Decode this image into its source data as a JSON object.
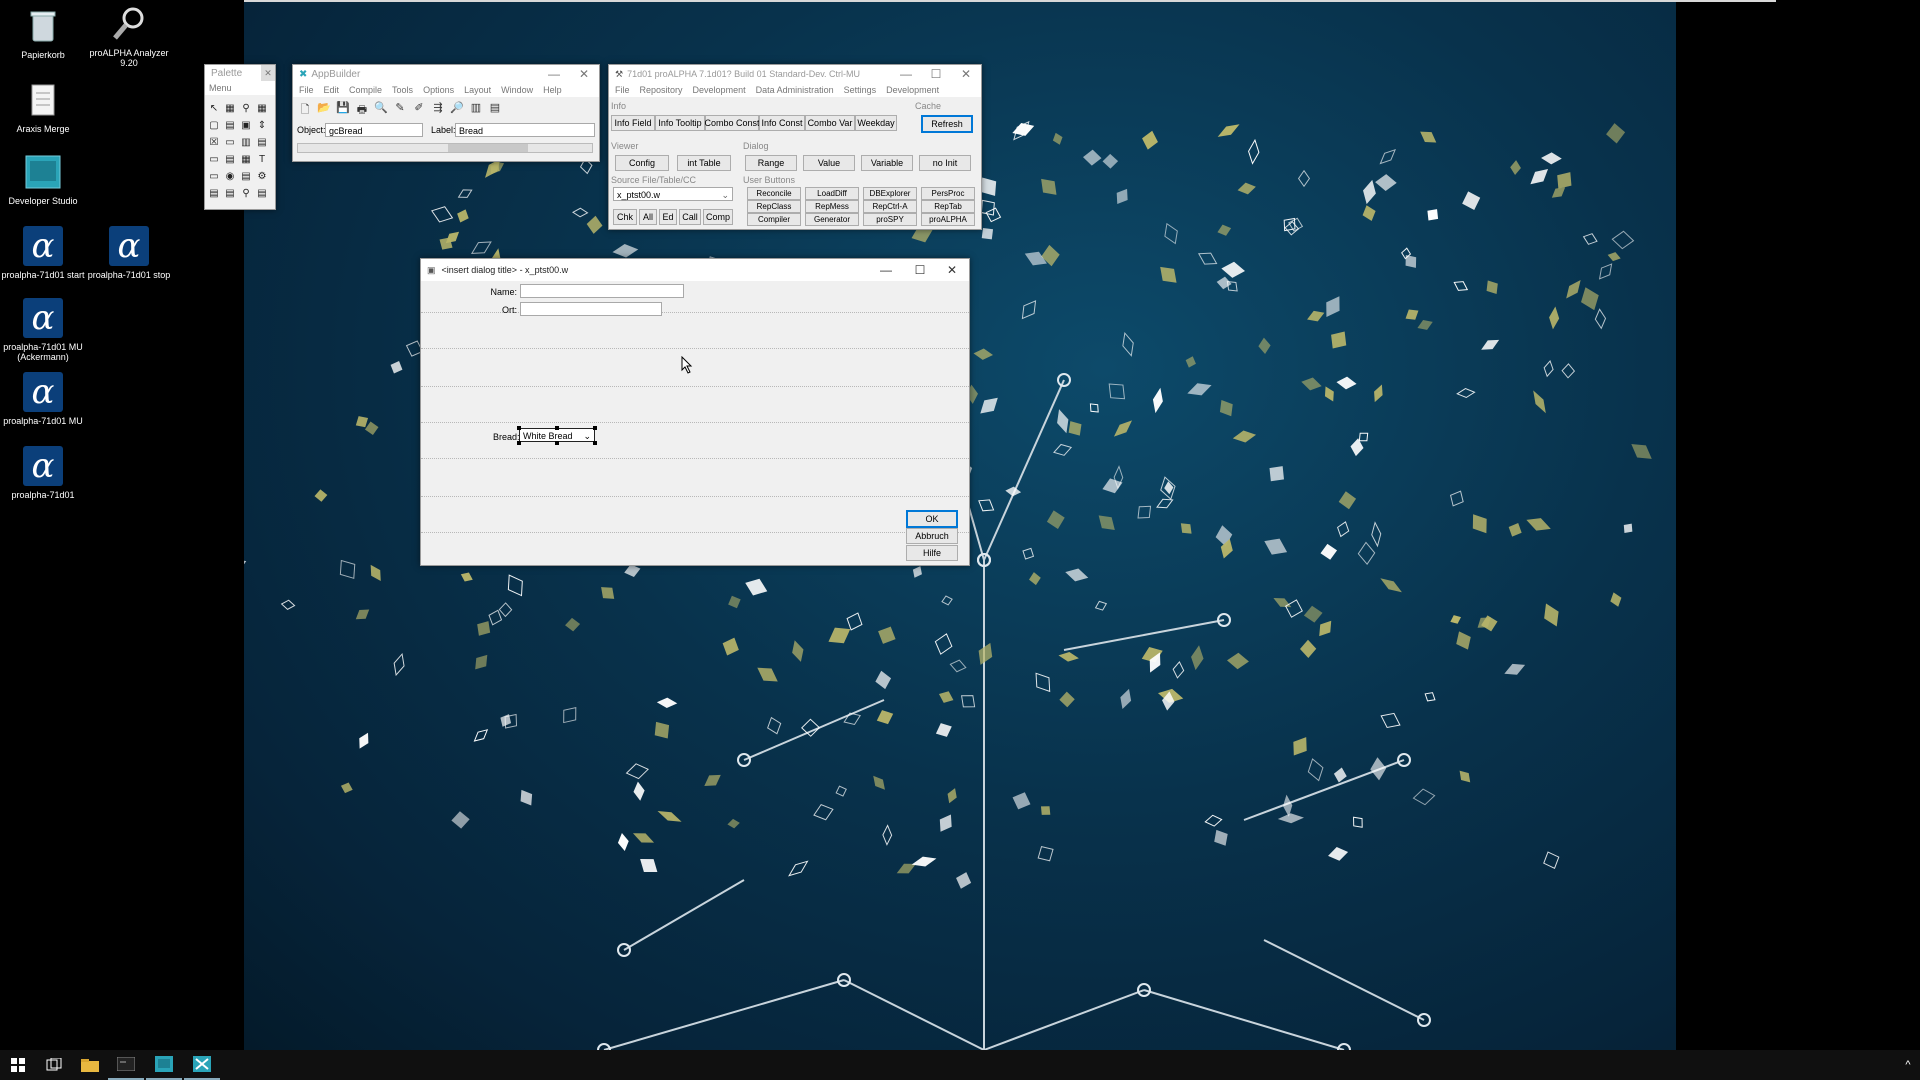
{
  "desktop": {
    "icons": [
      {
        "label": "Papierkorb",
        "icon": "recycle-bin-icon"
      },
      {
        "label": "proALPHA Analyzer 9.20",
        "icon": "magnifier-icon"
      },
      {
        "label": "Araxis Merge",
        "icon": "document-icon"
      },
      {
        "label": "Developer Studio",
        "icon": "studio-icon"
      },
      {
        "label": "proalpha-71d01 start",
        "icon": "alpha-icon"
      },
      {
        "label": "proalpha-71d01 stop",
        "icon": "alpha-icon"
      },
      {
        "label": "proalpha-71d01 MU (Ackermann)",
        "icon": "alpha-icon"
      },
      {
        "label": "proalpha-71d01 MU",
        "icon": "alpha-icon"
      },
      {
        "label": "proalpha-71d01",
        "icon": "alpha-icon"
      }
    ],
    "alpha_glyph": "α"
  },
  "palette": {
    "title": "Palette",
    "menu": "Menu",
    "close": "✕"
  },
  "appbuilder": {
    "title": "AppBuilder",
    "menu": [
      "File",
      "Edit",
      "Compile",
      "Tools",
      "Options",
      "Layout",
      "Window",
      "Help"
    ],
    "object_label": "Object:",
    "object_value": "gcBread",
    "label_label": "Label:",
    "label_value": "Bread"
  },
  "proalpha": {
    "title": "71d01 proALPHA 7.1d01? Build 01 Standard-Dev. Ctrl-MU",
    "menu": [
      "File",
      "Repository",
      "Development",
      "Data Administration",
      "Settings",
      "Development"
    ],
    "info_group": "Info",
    "info_buttons": [
      "Info Field",
      "Info Tooltip",
      "Combo Const",
      "Info Const",
      "Combo Var",
      "Weekday"
    ],
    "cache_group": "Cache",
    "refresh": "Refresh",
    "viewer_group": "Viewer",
    "viewer_buttons": [
      "Config",
      "int Table"
    ],
    "dialog_group": "Dialog",
    "dialog_buttons": [
      "Range",
      "Value",
      "Variable",
      "no Init"
    ],
    "source_group": "Source File/Table/CC",
    "source_value": "x_ptst00.w",
    "source_buttons": [
      "Chk",
      "All",
      "Ed",
      "Call",
      "Comp"
    ],
    "user_group": "User Buttons",
    "user_buttons": [
      [
        "Reconcile",
        "LoadDiff",
        "DBExplorer",
        "PersProc"
      ],
      [
        "RepClass",
        "RepMess",
        "RepCtrl-A",
        "RepTab"
      ],
      [
        "Compiler",
        "Generator",
        "proSPY",
        "proALPHA"
      ]
    ]
  },
  "dialog": {
    "title": "<insert dialog title> - x_ptst00.w",
    "name_label": "Name:",
    "name_value": "",
    "ort_label": "Ort:",
    "ort_value": "",
    "bread_label": "Bread:",
    "bread_value": "White Bread",
    "ok": "OK",
    "cancel": "Abbruch",
    "help": "Hilfe",
    "minimize": "—",
    "maximize": "☐",
    "close": "✕"
  },
  "taskbar": {
    "items": [
      "windows-start-icon",
      "task-view-icon",
      "file-explorer-icon",
      "terminal-icon",
      "developer-studio-icon",
      "appbuilder-icon"
    ],
    "tray": "^"
  },
  "colors": {
    "wallpaper": "#08324c",
    "leaf_light": "#ffffff",
    "leaf_olive": "#b9b66a",
    "alpha_blue": "#0b3f7a"
  }
}
